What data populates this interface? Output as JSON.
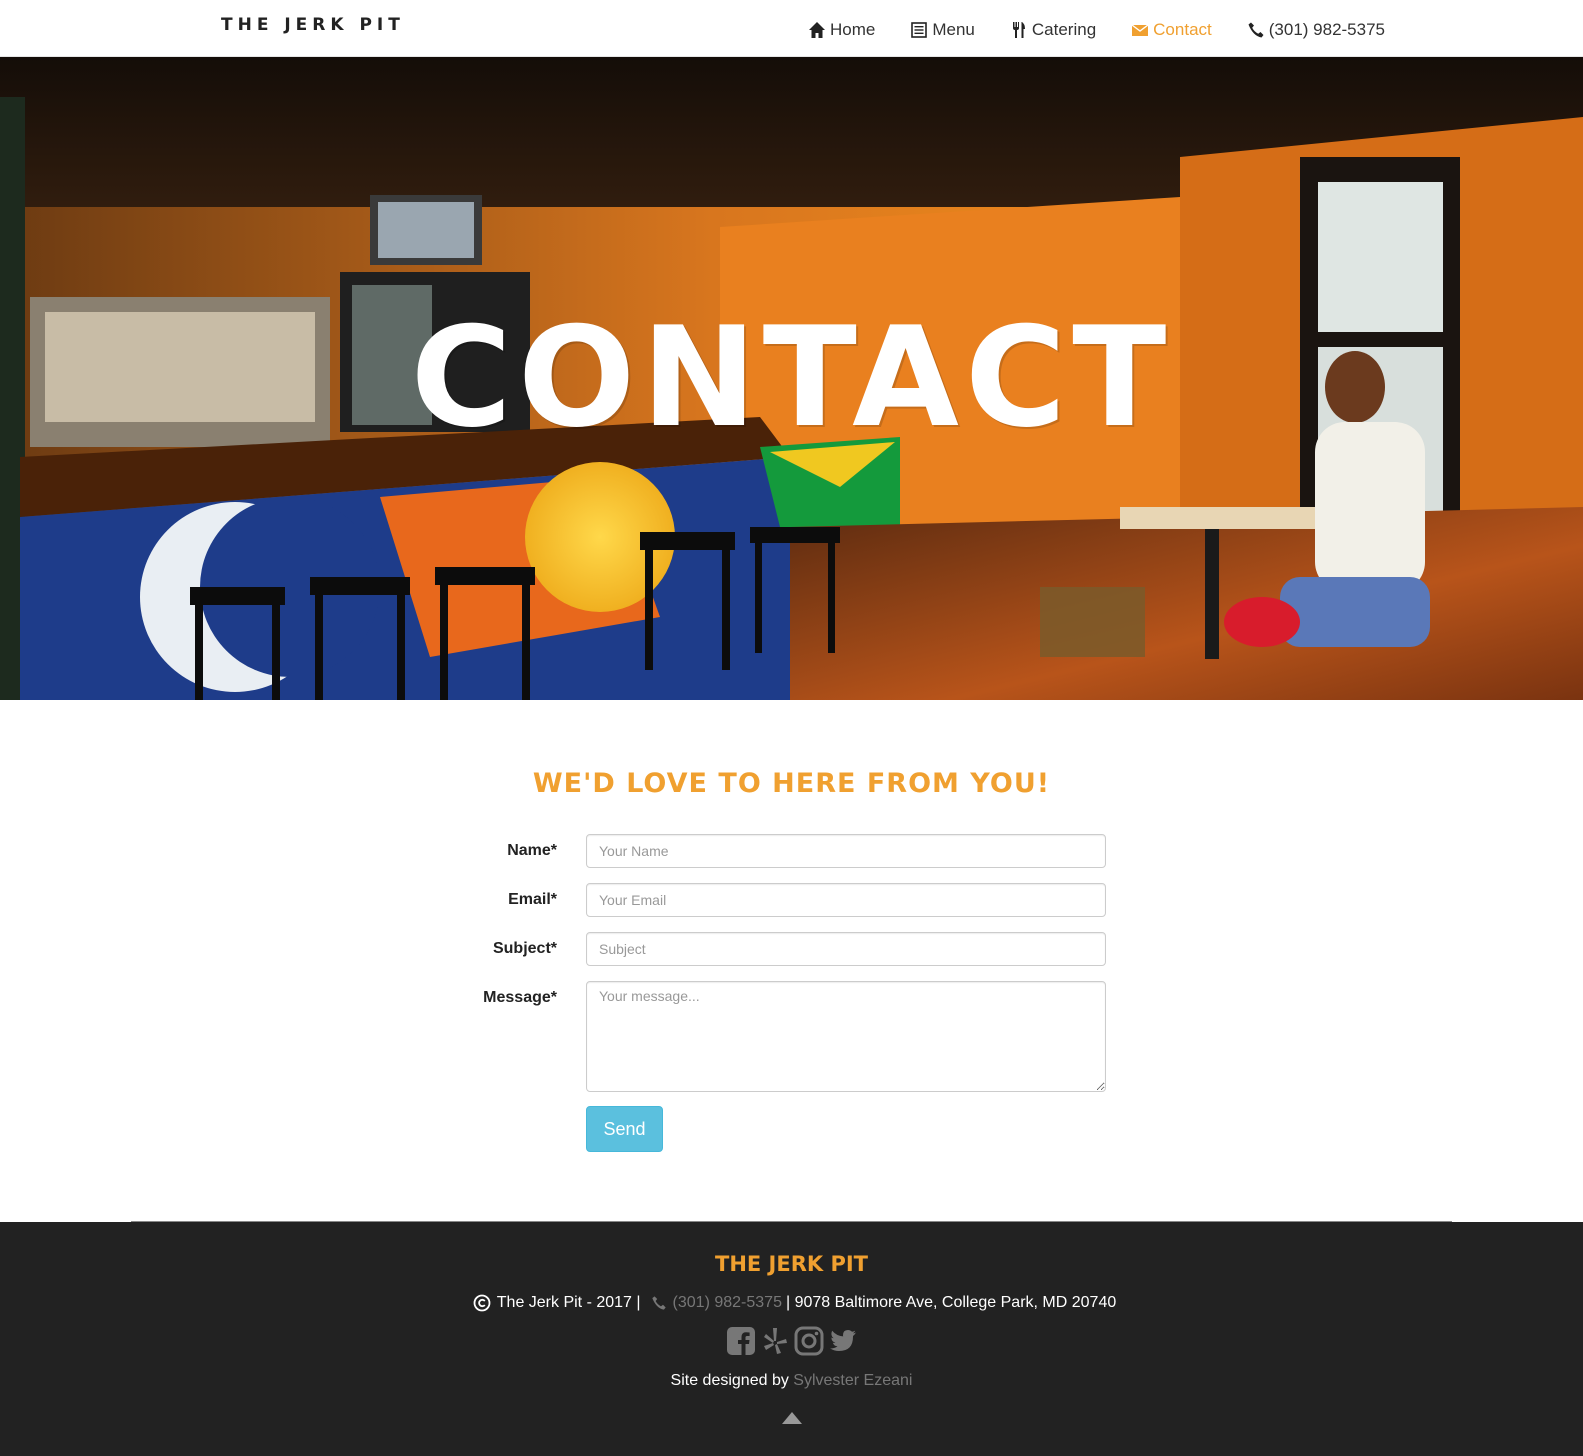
{
  "nav": {
    "brand": "THE JERK PIT",
    "items": [
      {
        "label": "Home",
        "icon": "home-icon"
      },
      {
        "label": "Menu",
        "icon": "list-icon"
      },
      {
        "label": "Catering",
        "icon": "cutlery-icon"
      },
      {
        "label": "Contact",
        "icon": "envelope-icon",
        "active": true
      },
      {
        "label": "(301) 982-5375",
        "icon": "phone-icon"
      }
    ]
  },
  "hero": {
    "title": "CONTACT"
  },
  "contact": {
    "heading": "WE'D LOVE TO HERE FROM YOU!",
    "fields": {
      "name_label": "Name*",
      "name_placeholder": "Your Name",
      "email_label": "Email*",
      "email_placeholder": "Your Email",
      "subject_label": "Subject*",
      "subject_placeholder": "Subject",
      "message_label": "Message*",
      "message_placeholder": "Your message..."
    },
    "send_label": "Send"
  },
  "footer": {
    "brand": "THE JERK PIT",
    "copyright": "The Jerk Pit - 2017 |",
    "phone": "(301) 982-5375",
    "address": "| 9078 Baltimore Ave, College Park, MD 20740",
    "social": [
      "facebook-icon",
      "yelp-icon",
      "instagram-icon",
      "twitter-icon"
    ],
    "credit_prefix": "Site designed by",
    "credit_name": "Sylvester Ezeani"
  },
  "colors": {
    "accent": "#f0a030",
    "button": "#5bc0de",
    "footer_bg": "#222222"
  }
}
